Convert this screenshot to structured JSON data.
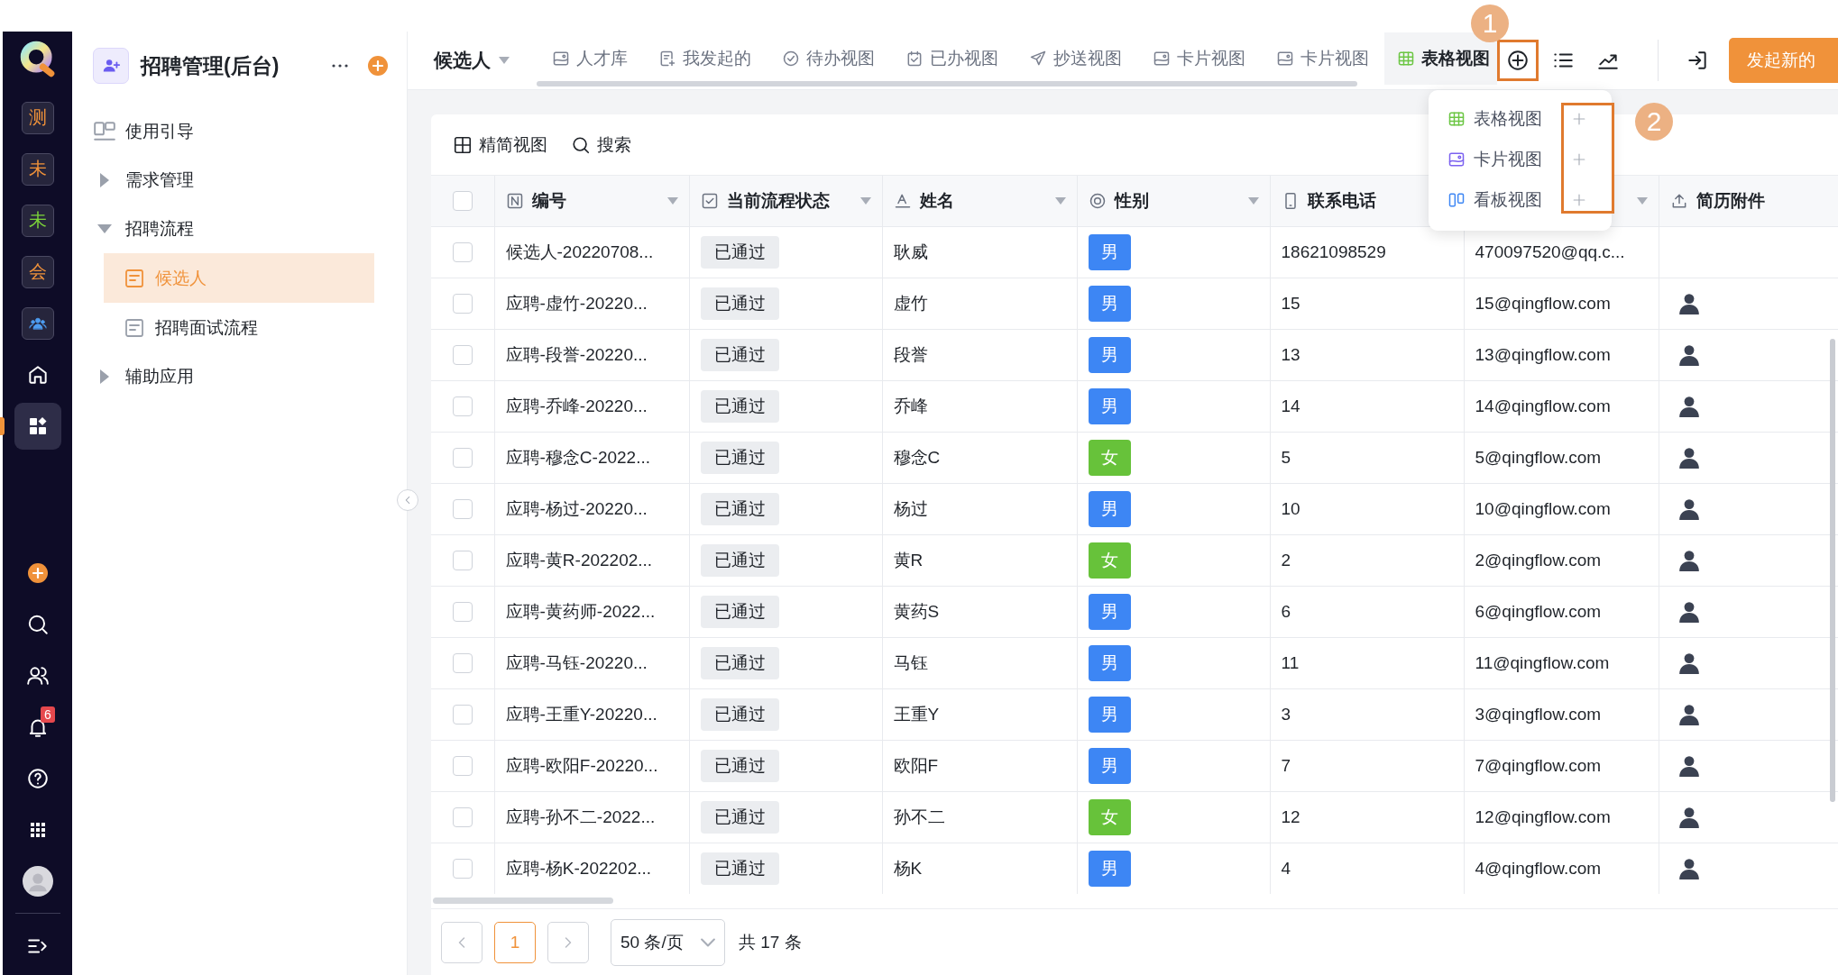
{
  "rail": {
    "items": [
      {
        "kind": "app",
        "label": "测",
        "color": "#f0923a",
        "selected": false
      },
      {
        "kind": "app",
        "label": "未",
        "color": "#f0923a",
        "selected": false
      },
      {
        "kind": "app",
        "label": "未",
        "color": "#7bd23a",
        "selected": false
      },
      {
        "kind": "app",
        "label": "会",
        "color": "#f0923a",
        "selected": false
      },
      {
        "kind": "team",
        "selected": false
      },
      {
        "kind": "home",
        "selected": false
      },
      {
        "kind": "apps",
        "selected": true
      }
    ],
    "tools": [
      {
        "kind": "add"
      },
      {
        "kind": "search"
      },
      {
        "kind": "users"
      },
      {
        "kind": "notifications",
        "badge": "6"
      },
      {
        "kind": "help"
      },
      {
        "kind": "launcher"
      },
      {
        "kind": "avatar"
      },
      {
        "kind": "expand"
      }
    ]
  },
  "sidebar": {
    "title": "招聘管理(后台)",
    "tree": [
      {
        "label": "使用引导",
        "kind": "guide",
        "selected": false
      },
      {
        "label": "需求管理",
        "kind": "group",
        "expanded": false,
        "selected": false
      },
      {
        "label": "招聘流程",
        "kind": "group",
        "expanded": true,
        "selected": false,
        "children": [
          {
            "label": "候选人",
            "kind": "form",
            "selected": true
          },
          {
            "label": "招聘面试流程",
            "kind": "form",
            "selected": false
          }
        ]
      },
      {
        "label": "辅助应用",
        "kind": "group",
        "expanded": false,
        "selected": false
      }
    ]
  },
  "header": {
    "title": "候选人",
    "tabs": [
      {
        "label": "人才库",
        "kind": "image",
        "selected": false
      },
      {
        "label": "我发起的",
        "kind": "doc_plus",
        "selected": false
      },
      {
        "label": "待办视图",
        "kind": "circle_check",
        "selected": false
      },
      {
        "label": "已办视图",
        "kind": "calendar_check",
        "selected": false
      },
      {
        "label": "抄送视图",
        "kind": "plane",
        "selected": false
      },
      {
        "label": "卡片视图",
        "kind": "image",
        "selected": false
      },
      {
        "label": "卡片视图",
        "kind": "image",
        "selected": false
      },
      {
        "label": "表格视图",
        "kind": "table",
        "selected": true
      }
    ],
    "primary_button": "发起新的"
  },
  "view_menu": {
    "items": [
      {
        "label": "表格视图",
        "kind": "table"
      },
      {
        "label": "卡片视图",
        "kind": "card"
      },
      {
        "label": "看板视图",
        "kind": "kanban"
      }
    ]
  },
  "annotations": [
    {
      "label": "1"
    },
    {
      "label": "2"
    }
  ],
  "toolbar": [
    {
      "label": "精简视图",
      "kind": "compact"
    },
    {
      "label": "搜索",
      "kind": "search"
    }
  ],
  "table": {
    "select_all_checked": false,
    "columns": [
      {
        "label": "编号",
        "kind": "serial",
        "sortable": true
      },
      {
        "label": "当前流程状态",
        "kind": "check",
        "sortable": true
      },
      {
        "label": "姓名",
        "kind": "text",
        "sortable": true
      },
      {
        "label": "性别",
        "kind": "radio",
        "sortable": true
      },
      {
        "label": "联系电话",
        "kind": "phone",
        "sortable": false
      },
      {
        "kind": "none",
        "sortable": true
      },
      {
        "label": "简历附件",
        "kind": "upload",
        "sortable": false
      }
    ],
    "rows": [
      {
        "checked": false,
        "id": "候选人-20220708...",
        "status": "已通过",
        "name": "耿威",
        "gender": {
          "text": "男",
          "color": "#3d86f4"
        },
        "phone": "18621098529",
        "email": "470097520@qq.c...",
        "attachment": false
      },
      {
        "checked": false,
        "id": "应聘-虚竹-20220...",
        "status": "已通过",
        "name": "虚竹",
        "gender": {
          "text": "男",
          "color": "#3d86f4"
        },
        "phone": "15",
        "email": "15@qingflow.com",
        "attachment": true
      },
      {
        "checked": false,
        "id": "应聘-段誉-20220...",
        "status": "已通过",
        "name": "段誉",
        "gender": {
          "text": "男",
          "color": "#3d86f4"
        },
        "phone": "13",
        "email": "13@qingflow.com",
        "attachment": true
      },
      {
        "checked": false,
        "id": "应聘-乔峰-20220...",
        "status": "已通过",
        "name": "乔峰",
        "gender": {
          "text": "男",
          "color": "#3d86f4"
        },
        "phone": "14",
        "email": "14@qingflow.com",
        "attachment": true
      },
      {
        "checked": false,
        "id": "应聘-穆念C-2022...",
        "status": "已通过",
        "name": "穆念C",
        "gender": {
          "text": "女",
          "color": "#67c23a"
        },
        "phone": "5",
        "email": "5@qingflow.com",
        "attachment": true
      },
      {
        "checked": false,
        "id": "应聘-杨过-20220...",
        "status": "已通过",
        "name": "杨过",
        "gender": {
          "text": "男",
          "color": "#3d86f4"
        },
        "phone": "10",
        "email": "10@qingflow.com",
        "attachment": true
      },
      {
        "checked": false,
        "id": "应聘-黄R-202202...",
        "status": "已通过",
        "name": "黄R",
        "gender": {
          "text": "女",
          "color": "#67c23a"
        },
        "phone": "2",
        "email": "2@qingflow.com",
        "attachment": true
      },
      {
        "checked": false,
        "id": "应聘-黄药师-2022...",
        "status": "已通过",
        "name": "黄药S",
        "gender": {
          "text": "男",
          "color": "#3d86f4"
        },
        "phone": "6",
        "email": "6@qingflow.com",
        "attachment": true
      },
      {
        "checked": false,
        "id": "应聘-马钰-20220...",
        "status": "已通过",
        "name": "马钰",
        "gender": {
          "text": "男",
          "color": "#3d86f4"
        },
        "phone": "11",
        "email": "11@qingflow.com",
        "attachment": true
      },
      {
        "checked": false,
        "id": "应聘-王重Y-20220...",
        "status": "已通过",
        "name": "王重Y",
        "gender": {
          "text": "男",
          "color": "#3d86f4"
        },
        "phone": "3",
        "email": "3@qingflow.com",
        "attachment": true
      },
      {
        "checked": false,
        "id": "应聘-欧阳F-20220...",
        "status": "已通过",
        "name": "欧阳F",
        "gender": {
          "text": "男",
          "color": "#3d86f4"
        },
        "phone": "7",
        "email": "7@qingflow.com",
        "attachment": true
      },
      {
        "checked": false,
        "id": "应聘-孙不二-2022...",
        "status": "已通过",
        "name": "孙不二",
        "gender": {
          "text": "女",
          "color": "#67c23a"
        },
        "phone": "12",
        "email": "12@qingflow.com",
        "attachment": true
      },
      {
        "checked": false,
        "id": "应聘-杨K-202202...",
        "status": "已通过",
        "name": "杨K",
        "gender": {
          "text": "男",
          "color": "#3d86f4"
        },
        "phone": "4",
        "email": "4@qingflow.com",
        "attachment": true
      }
    ]
  },
  "pagination": {
    "prev_disabled": true,
    "next_disabled": true,
    "pages": [
      {
        "label": "1",
        "selected": true
      }
    ],
    "page_size": "50 条/页",
    "total": "共 17 条"
  }
}
